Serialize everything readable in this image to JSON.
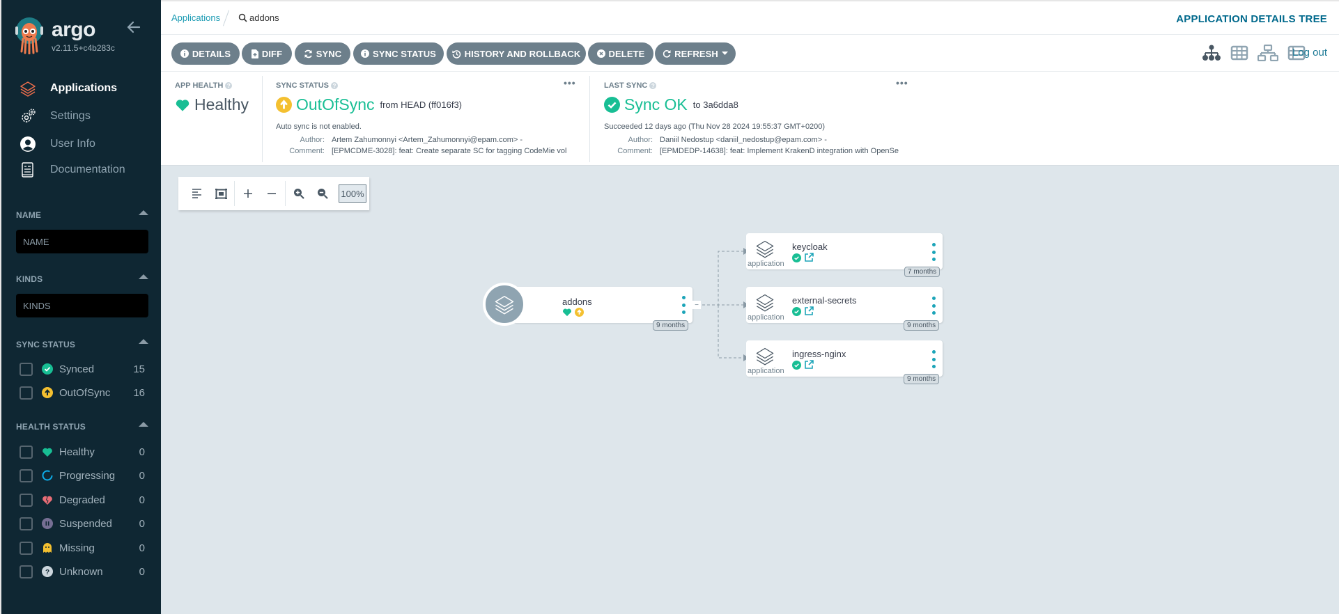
{
  "sidebar": {
    "brand": "argo",
    "version": "v2.11.5+c4b283c",
    "nav": [
      {
        "label": "Applications",
        "icon": "layers-icon",
        "active": true
      },
      {
        "label": "Settings",
        "icon": "gears-icon",
        "active": false
      },
      {
        "label": "User Info",
        "icon": "user-circle-icon",
        "active": false
      },
      {
        "label": "Documentation",
        "icon": "book-icon",
        "active": false
      }
    ],
    "filters": {
      "name": {
        "title": "NAME",
        "placeholder": "NAME"
      },
      "kinds": {
        "title": "KINDS",
        "placeholder": "KINDS"
      },
      "sync_status": {
        "title": "SYNC STATUS",
        "items": [
          {
            "label": "Synced",
            "count": "15",
            "icon": "check-circle-icon",
            "color": "#18be94"
          },
          {
            "label": "OutOfSync",
            "count": "16",
            "icon": "arrow-up-circle-icon",
            "color": "#f4c030"
          }
        ]
      },
      "health_status": {
        "title": "HEALTH STATUS",
        "items": [
          {
            "label": "Healthy",
            "count": "0",
            "icon": "heart-icon",
            "color": "#18be94"
          },
          {
            "label": "Progressing",
            "count": "0",
            "icon": "spinner-icon",
            "color": "#0dadea"
          },
          {
            "label": "Degraded",
            "count": "0",
            "icon": "heart-broken-icon",
            "color": "#e96d76"
          },
          {
            "label": "Suspended",
            "count": "0",
            "icon": "pause-circle-icon",
            "color": "#766f94"
          },
          {
            "label": "Missing",
            "count": "0",
            "icon": "ghost-icon",
            "color": "#f4c030"
          },
          {
            "label": "Unknown",
            "count": "0",
            "icon": "question-circle-icon",
            "color": "#ccd6dd"
          }
        ]
      }
    }
  },
  "topbar": {
    "breadcrumb_root": "Applications",
    "breadcrumb_current": "addons",
    "title": "APPLICATION DETAILS TREE"
  },
  "toolbar": {
    "buttons": [
      {
        "label": "DETAILS",
        "icon": "info-circle-icon"
      },
      {
        "label": "DIFF",
        "icon": "file-diff-icon"
      },
      {
        "label": "SYNC",
        "icon": "sync-icon"
      },
      {
        "label": "SYNC STATUS",
        "icon": "info-circle-icon"
      },
      {
        "label": "HISTORY AND ROLLBACK",
        "icon": "history-icon"
      },
      {
        "label": "DELETE",
        "icon": "times-circle-icon"
      },
      {
        "label": "REFRESH",
        "icon": "redo-icon"
      }
    ],
    "view_modes": [
      "tree-view-icon",
      "pods-view-icon",
      "network-view-icon",
      "list-view-icon"
    ],
    "logout": "Log out"
  },
  "status": {
    "app_health": {
      "label": "APP HEALTH",
      "value": "Healthy",
      "color": "#18be94"
    },
    "sync_status": {
      "label": "SYNC STATUS",
      "value": "OutOfSync",
      "detail": "from HEAD (ff016f3)",
      "auto_sync": "Auto sync is not enabled.",
      "author_label": "Author:",
      "author": "Artem Zahumonnyi <Artem_Zahumonnyi@epam.com> -",
      "comment_label": "Comment:",
      "comment": "[EPMCDME-3028]: feat: Create separate SC for tagging CodeMie vol",
      "color": "#18be94"
    },
    "last_sync": {
      "label": "LAST SYNC",
      "value": "Sync OK",
      "detail": "to 3a6dda8",
      "succeeded": "Succeeded 12 days ago (Thu Nov 28 2024 19:55:37 GMT+0200)",
      "author_label": "Author:",
      "author": "Daniil Nedostup <daniil_nedostup@epam.com> -",
      "comment_label": "Comment:",
      "comment": "[EPMDEDP-14638]: feat: Implement KrakenD integration with OpenSe",
      "color": "#18be94"
    },
    "more": "•••"
  },
  "graph_tools": {
    "zoom_level": "100%"
  },
  "graph": {
    "root": {
      "name": "addons",
      "age": "9 months",
      "collapse": "−"
    },
    "children": [
      {
        "name": "keycloak",
        "kind": "application",
        "age": "7 months"
      },
      {
        "name": "external-secrets",
        "kind": "application",
        "age": "9 months"
      },
      {
        "name": "ingress-nginx",
        "kind": "application",
        "age": "9 months"
      }
    ]
  }
}
